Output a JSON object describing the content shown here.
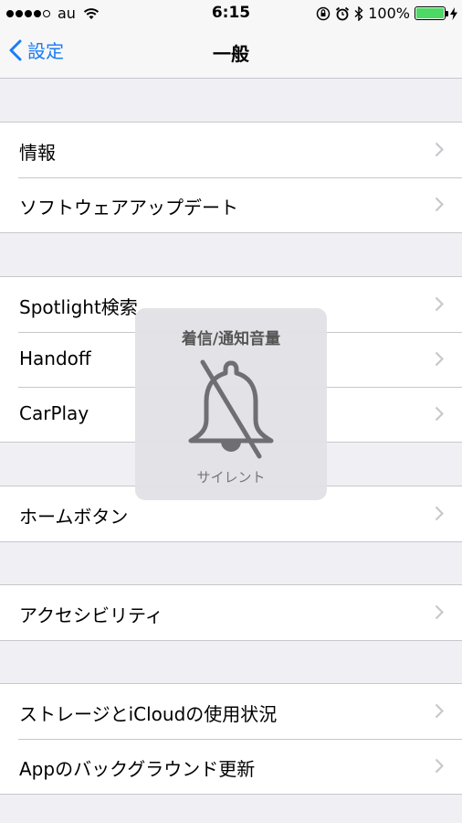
{
  "status_bar": {
    "carrier": "au",
    "time": "6:15",
    "battery": "100%",
    "signal_bars_filled": 4,
    "signal_bars_total": 5
  },
  "nav": {
    "back_label": "設定",
    "title": "一般"
  },
  "groups": [
    {
      "items": [
        {
          "label": "情報"
        },
        {
          "label": "ソフトウェアアップデート"
        }
      ]
    },
    {
      "items": [
        {
          "label": "Spotlight検索"
        },
        {
          "label": "Handoff"
        },
        {
          "label": "CarPlay"
        }
      ]
    },
    {
      "items": [
        {
          "label": "ホームボタン"
        }
      ]
    },
    {
      "items": [
        {
          "label": "アクセシビリティ"
        }
      ]
    },
    {
      "items": [
        {
          "label": "ストレージとiCloudの使用状況"
        },
        {
          "label": "Appのバックグラウンド更新"
        }
      ]
    }
  ],
  "volume_hud": {
    "title": "着信/通知音量",
    "subtitle": "サイレント",
    "icon": "bell-muted-icon"
  },
  "colors": {
    "accent": "#1a7cf5",
    "background": "#efeff4",
    "battery": "#4cd964"
  }
}
